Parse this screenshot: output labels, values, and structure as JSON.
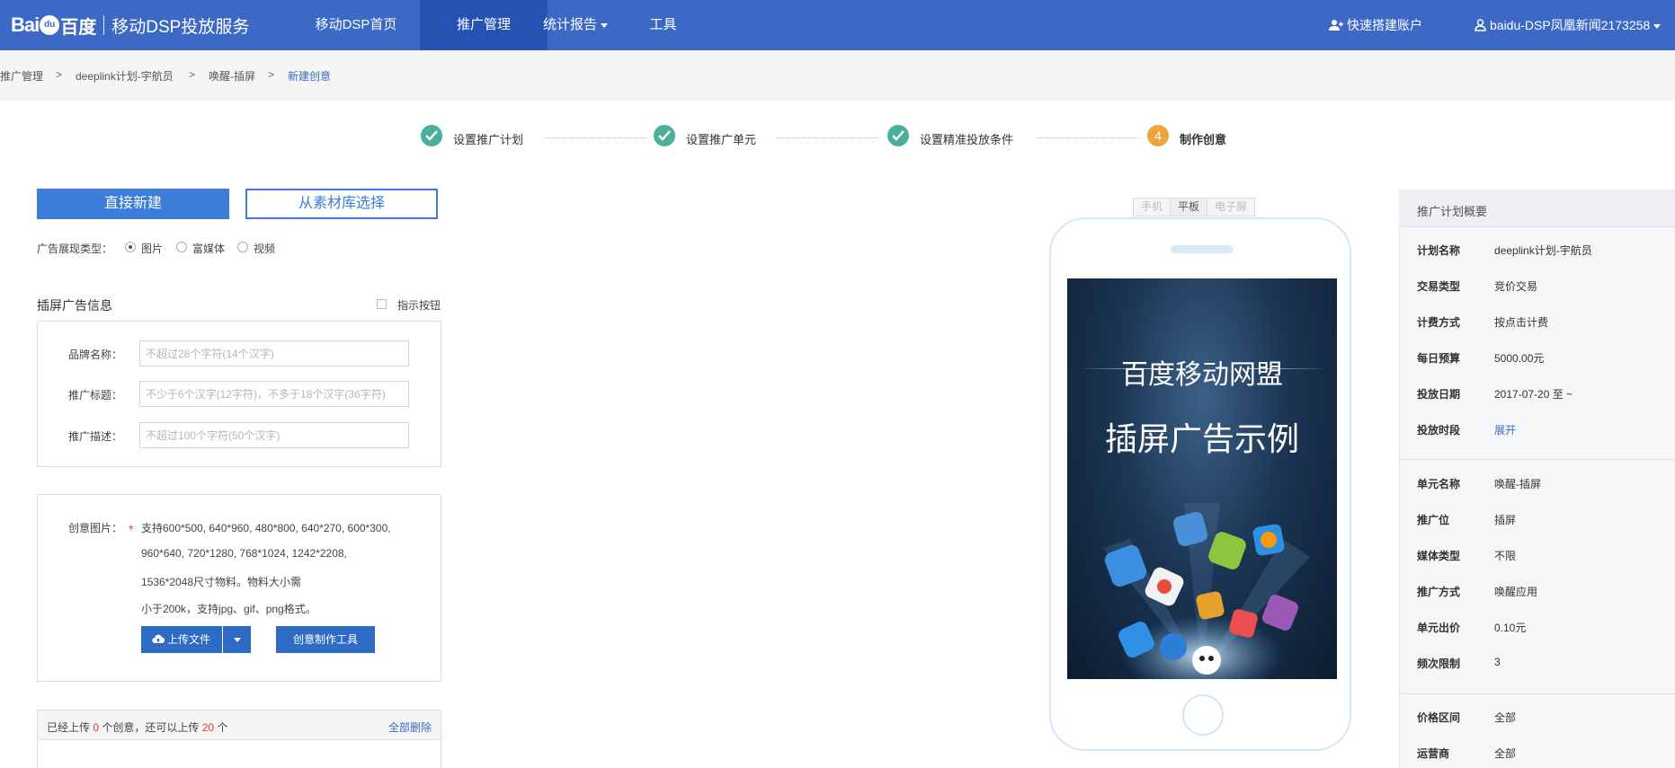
{
  "header": {
    "logo_bai": "Bai",
    "logo_du": "du",
    "logo_cn": "百度",
    "service_name": "移动DSP投放服务",
    "nav": [
      {
        "label": "移动DSP首页"
      },
      {
        "label": "推广管理"
      },
      {
        "label": "统计报告"
      },
      {
        "label": "工具"
      }
    ],
    "quick_account": "快速搭建账户",
    "user": "baidu-DSP凤凰新闻2173258"
  },
  "breadcrumb": [
    "推广管理",
    "deeplink计划-宇航员",
    "唤醒-插屏",
    "新建创意"
  ],
  "breadcrumb_sep": ">",
  "steps": [
    {
      "label": "设置推广计划",
      "state": "done"
    },
    {
      "label": "设置推广单元",
      "state": "done"
    },
    {
      "label": "设置精准投放条件",
      "state": "done"
    },
    {
      "label": "制作创意",
      "state": "current",
      "number": "4"
    }
  ],
  "creative": {
    "btn_direct": "直接新建",
    "btn_library": "从素材库选择",
    "ad_type_label": "广告展现类型：",
    "ad_types": [
      "图片",
      "富媒体",
      "视频"
    ],
    "ad_type_selected": "图片",
    "section_title": "插屏广告信息",
    "indicator_label": "指示按钮",
    "brand_label": "品牌名称：",
    "brand_placeholder": "不超过28个字符(14个汉字)",
    "title_label": "推广标题：",
    "title_placeholder": "不少于6个汉字(12字符)，不多于18个汉字(36字符)",
    "desc_label": "推广描述：",
    "desc_placeholder": "不超过100个字符(50个汉字)",
    "image_label": "创意图片：",
    "image_req": "*",
    "image_hint": [
      "支持600*500, 640*960, 480*800, 640*270, 600*300,",
      "960*640, 720*1280, 768*1024, 1242*2208,",
      "1536*2048尺寸物料。物料大小需",
      "小于200k，支持jpg、gif、png格式。"
    ],
    "upload_btn": "上传文件",
    "tool_btn": "创意制作工具",
    "uploaded_prefix": "已经上传",
    "uploaded_count": "0",
    "uploaded_mid": "个创意，还可以上传",
    "remaining_count": "20",
    "uploaded_suffix": "个",
    "delete_all": "全部删除"
  },
  "preview": {
    "device_tabs": [
      "手机",
      "平板",
      "电子屏"
    ],
    "active_tab": "手机",
    "screen_line1": "百度移动网盟",
    "screen_line2": "插屏广告示例"
  },
  "summary": {
    "title": "推广计划概要",
    "plan": [
      {
        "k": "计划名称",
        "v": "deeplink计划-宇航员"
      },
      {
        "k": "交易类型",
        "v": "竞价交易"
      },
      {
        "k": "计费方式",
        "v": "按点击计费"
      },
      {
        "k": "每日预算",
        "v": "5000.00元"
      },
      {
        "k": "投放日期",
        "v": "2017-07-20 至 ~"
      },
      {
        "k": "投放时段",
        "v": "展开"
      }
    ],
    "unit": [
      {
        "k": "单元名称",
        "v": "唤醒-插屏"
      },
      {
        "k": "推广位",
        "v": "插屏"
      },
      {
        "k": "媒体类型",
        "v": "不限"
      },
      {
        "k": "推广方式",
        "v": "唤醒应用"
      },
      {
        "k": "单元出价",
        "v": "0.10元"
      },
      {
        "k": "频次限制",
        "v": "3"
      }
    ],
    "target": [
      {
        "k": "价格区间",
        "v": "全部"
      },
      {
        "k": "运营商",
        "v": "全部"
      }
    ]
  },
  "colors": {
    "nav_bg": "#3b69c5",
    "nav_active": "#2553b3",
    "step_done": "#4cae9c",
    "step_current": "#f0a43c",
    "primary": "#3b7dd8",
    "count_red": "#e33"
  }
}
